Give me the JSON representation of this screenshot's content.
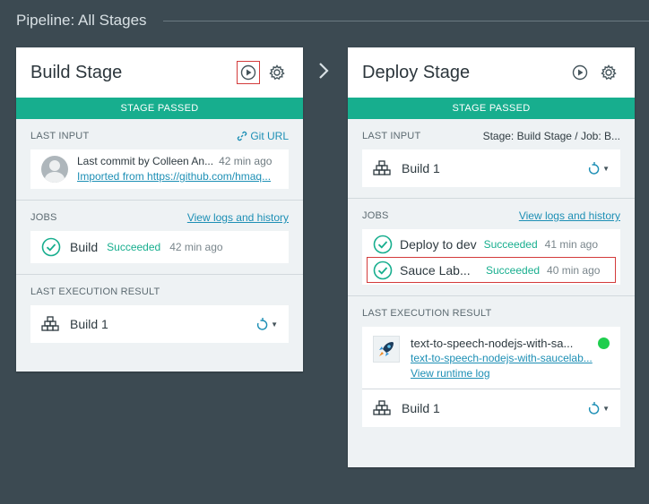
{
  "page": {
    "title": "Pipeline: All Stages"
  },
  "build_stage": {
    "title": "Build Stage",
    "status": "STAGE PASSED",
    "last_input": {
      "label": "LAST INPUT",
      "link": "Git URL",
      "commit_message": "Last commit by Colleen An...",
      "commit_time": "42 min ago",
      "commit_link": "Imported from https://github.com/hmaq..."
    },
    "jobs": {
      "label": "JOBS",
      "link": "View logs and history",
      "items": [
        {
          "name": "Build",
          "status": "Succeeded",
          "time": "42 min ago"
        }
      ]
    },
    "last_execution": {
      "label": "LAST EXECUTION RESULT",
      "build": "Build 1"
    }
  },
  "deploy_stage": {
    "title": "Deploy Stage",
    "status": "STAGE PASSED",
    "last_input": {
      "label": "LAST INPUT",
      "meta": "Stage: Build Stage  /  Job: B...",
      "build": "Build 1"
    },
    "jobs": {
      "label": "JOBS",
      "link": "View logs and history",
      "items": [
        {
          "name": "Deploy to dev",
          "status": "Succeeded",
          "time": "41 min ago"
        },
        {
          "name": "Sauce Lab...",
          "status": "Succeeded",
          "time": "40 min ago"
        }
      ]
    },
    "last_execution": {
      "label": "LAST EXECUTION RESULT",
      "app_name": "text-to-speech-nodejs-with-sa...",
      "app_link": "text-to-speech-nodejs-with-saucelab...",
      "runtime_log": "View runtime log",
      "build": "Build 1"
    }
  },
  "colors": {
    "accent": "#17ae8e",
    "link": "#1d8fb5",
    "highlight": "#d33b3b",
    "running": "#1fce4e"
  }
}
